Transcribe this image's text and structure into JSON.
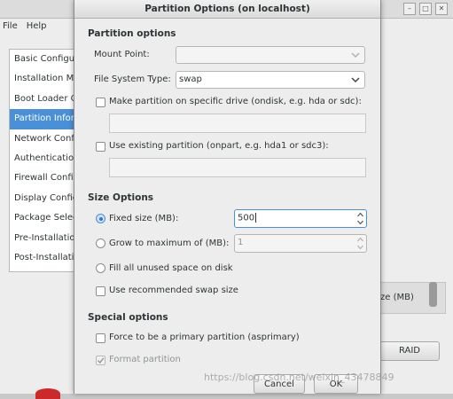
{
  "background_app": {
    "menu": [
      "File",
      "Help"
    ],
    "sidebar_items": [
      "Basic Configuration",
      "Installation Method",
      "Boot Loader Options",
      "Partition Information",
      "Network Configuration",
      "Authentication",
      "Firewall Configuration",
      "Display Configuration",
      "Package Selection",
      "Pre-Installation Script",
      "Post-Installation Script"
    ],
    "table_header_fragment": "ze (MB)",
    "raid_button": "RAID"
  },
  "dialog": {
    "title": "Partition Options (on localhost)",
    "partition_options": {
      "heading": "Partition options",
      "mount_point_label": "Mount Point:",
      "mount_point_value": "",
      "fs_type_label": "File System Type:",
      "fs_type_value": "swap",
      "specific_drive_label": "Make partition on specific drive (ondisk, e.g. hda or sdc):",
      "existing_partition_label": "Use existing partition (onpart, e.g. hda1 or sdc3):"
    },
    "size_options": {
      "heading": "Size Options",
      "fixed_size_label": "Fixed size (MB):",
      "fixed_size_value": "500",
      "grow_label": "Grow to maximum of (MB):",
      "grow_value": "1",
      "fill_label": "Fill all unused space on disk",
      "recommended_swap_label": "Use recommended swap size",
      "selected_option": "fixed_size"
    },
    "special_options": {
      "heading": "Special options",
      "primary_label": "Force to be a primary partition (asprimary)",
      "primary_checked": false,
      "format_label": "Format partition",
      "format_checked": true,
      "format_enabled": false
    },
    "buttons": {
      "cancel": "Cancel",
      "ok": "OK"
    }
  },
  "watermark": "https://blog.csdn.net/weixin_43478849",
  "colors": {
    "selection": "#4a90d9",
    "dialog_bg": "#ededed"
  }
}
